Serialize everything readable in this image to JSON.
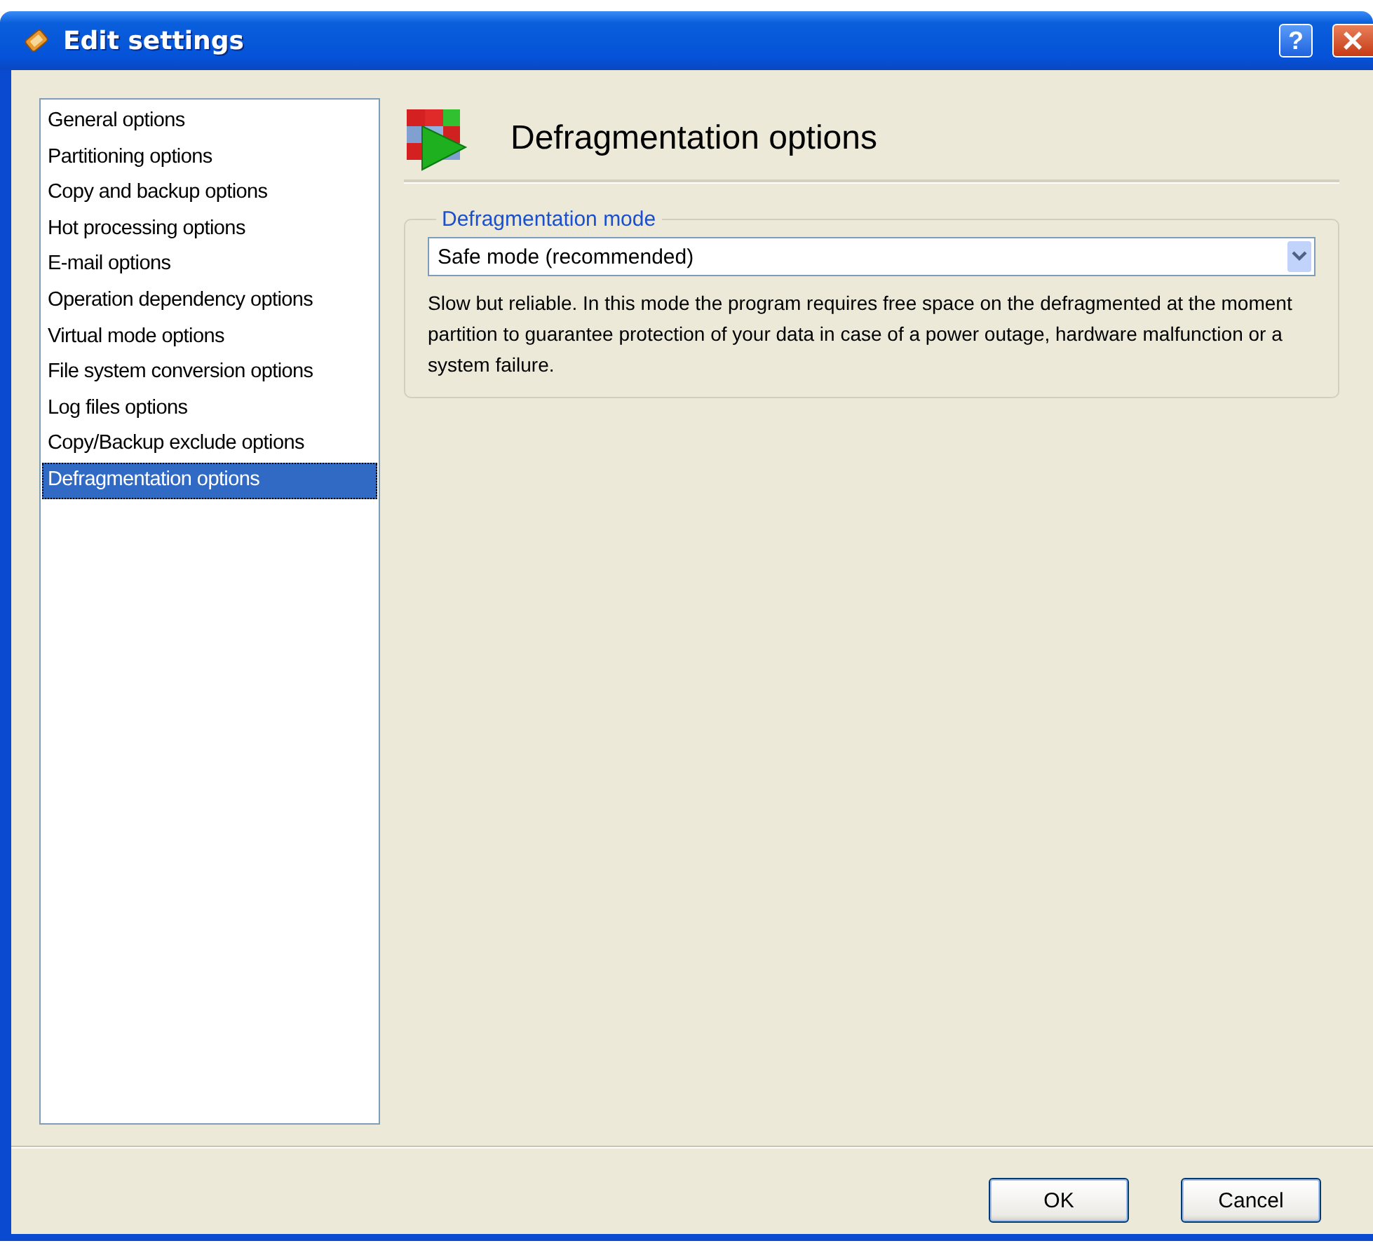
{
  "window": {
    "title": "Edit settings",
    "help_button": "?"
  },
  "sidebar": {
    "items": [
      {
        "label": "General options",
        "selected": false
      },
      {
        "label": "Partitioning options",
        "selected": false
      },
      {
        "label": "Copy and backup options",
        "selected": false
      },
      {
        "label": "Hot processing options",
        "selected": false
      },
      {
        "label": "E-mail options",
        "selected": false
      },
      {
        "label": "Operation dependency options",
        "selected": false
      },
      {
        "label": "Virtual mode options",
        "selected": false
      },
      {
        "label": "File system conversion options",
        "selected": false
      },
      {
        "label": "Log files options",
        "selected": false
      },
      {
        "label": "Copy/Backup exclude options",
        "selected": false
      },
      {
        "label": "Defragmentation options",
        "selected": true
      }
    ]
  },
  "page": {
    "title": "Defragmentation options",
    "group": {
      "label": "Defragmentation mode",
      "dropdown": {
        "value": "Safe mode (recommended)"
      },
      "description": "Slow but reliable. In this mode the program requires free space on the defragmented at the moment partition to guarantee protection of your data in case of a power outage, hardware malfunction or a system failure."
    }
  },
  "buttons": [
    "OK",
    "Cancel"
  ]
}
